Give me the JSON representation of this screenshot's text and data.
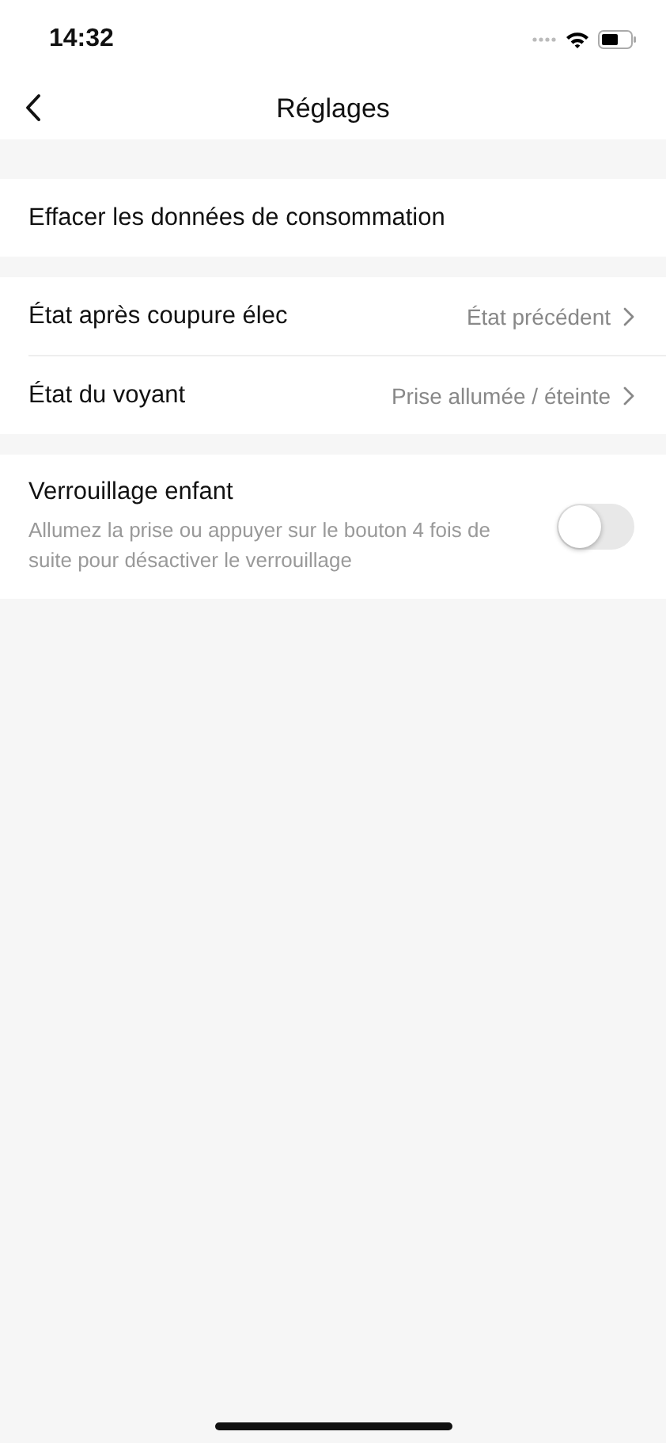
{
  "status_bar": {
    "time": "14:32"
  },
  "nav_bar": {
    "title": "Réglages"
  },
  "sections": [
    {
      "items": [
        {
          "kind": "action",
          "label": "Effacer les données de consommation"
        }
      ]
    },
    {
      "items": [
        {
          "kind": "link",
          "label": "État après coupure élec",
          "value": "État précédent"
        },
        {
          "kind": "link",
          "label": "État du voyant",
          "value": "Prise allumée / éteinte"
        }
      ]
    },
    {
      "items": [
        {
          "kind": "toggle",
          "label": "Verrouillage enfant",
          "description": "Allumez la prise ou appuyer sur le bouton 4 fois de suite pour désactiver le verrouillage",
          "on": false
        }
      ]
    }
  ]
}
